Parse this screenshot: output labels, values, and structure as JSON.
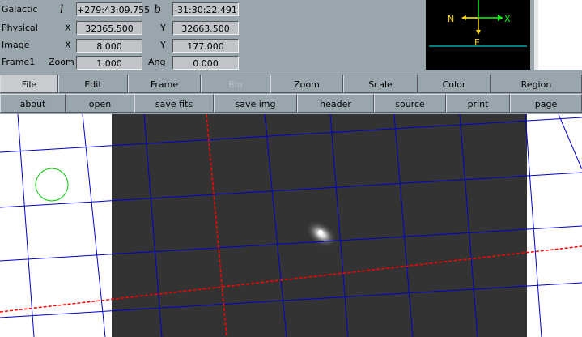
{
  "info": {
    "coord_system": "Galactic",
    "lon_symbol": "l",
    "lon_value": "+279:43:09.755",
    "lat_symbol": "b",
    "lat_value": "-31:30:22.491",
    "physical_label": "Physical",
    "physical_x_label": "X",
    "physical_x": "32365.500",
    "physical_y_label": "Y",
    "physical_y": "32663.500",
    "image_label": "Image",
    "image_x_label": "X",
    "image_x": "8.000",
    "image_y_label": "Y",
    "image_y": "177.000",
    "frame_label": "Frame1",
    "zoom_label": "Zoom",
    "zoom": "1.000",
    "angle_label": "Ang",
    "angle": "0.000"
  },
  "panner": {
    "north_label": "N",
    "east_label": "E",
    "arrow_color": "#ffd400",
    "axis_color": "#00ff00"
  },
  "menubar": [
    {
      "label": "File",
      "active": true
    },
    {
      "label": "Edit"
    },
    {
      "label": "Frame"
    },
    {
      "label": "Bin",
      "disabled": true
    },
    {
      "label": "Zoom"
    },
    {
      "label": "Scale"
    },
    {
      "label": "Color"
    },
    {
      "label": "Region"
    }
  ],
  "buttonbar": [
    {
      "label": "about"
    },
    {
      "label": "open"
    },
    {
      "label": "save fits"
    },
    {
      "label": "save img"
    },
    {
      "label": "header"
    },
    {
      "label": "source"
    },
    {
      "label": "print"
    },
    {
      "label": "page"
    }
  ],
  "overlay": {
    "grid_color": "#0000cc",
    "axis_color": "#ff0000",
    "region_color": "#00cc00"
  }
}
